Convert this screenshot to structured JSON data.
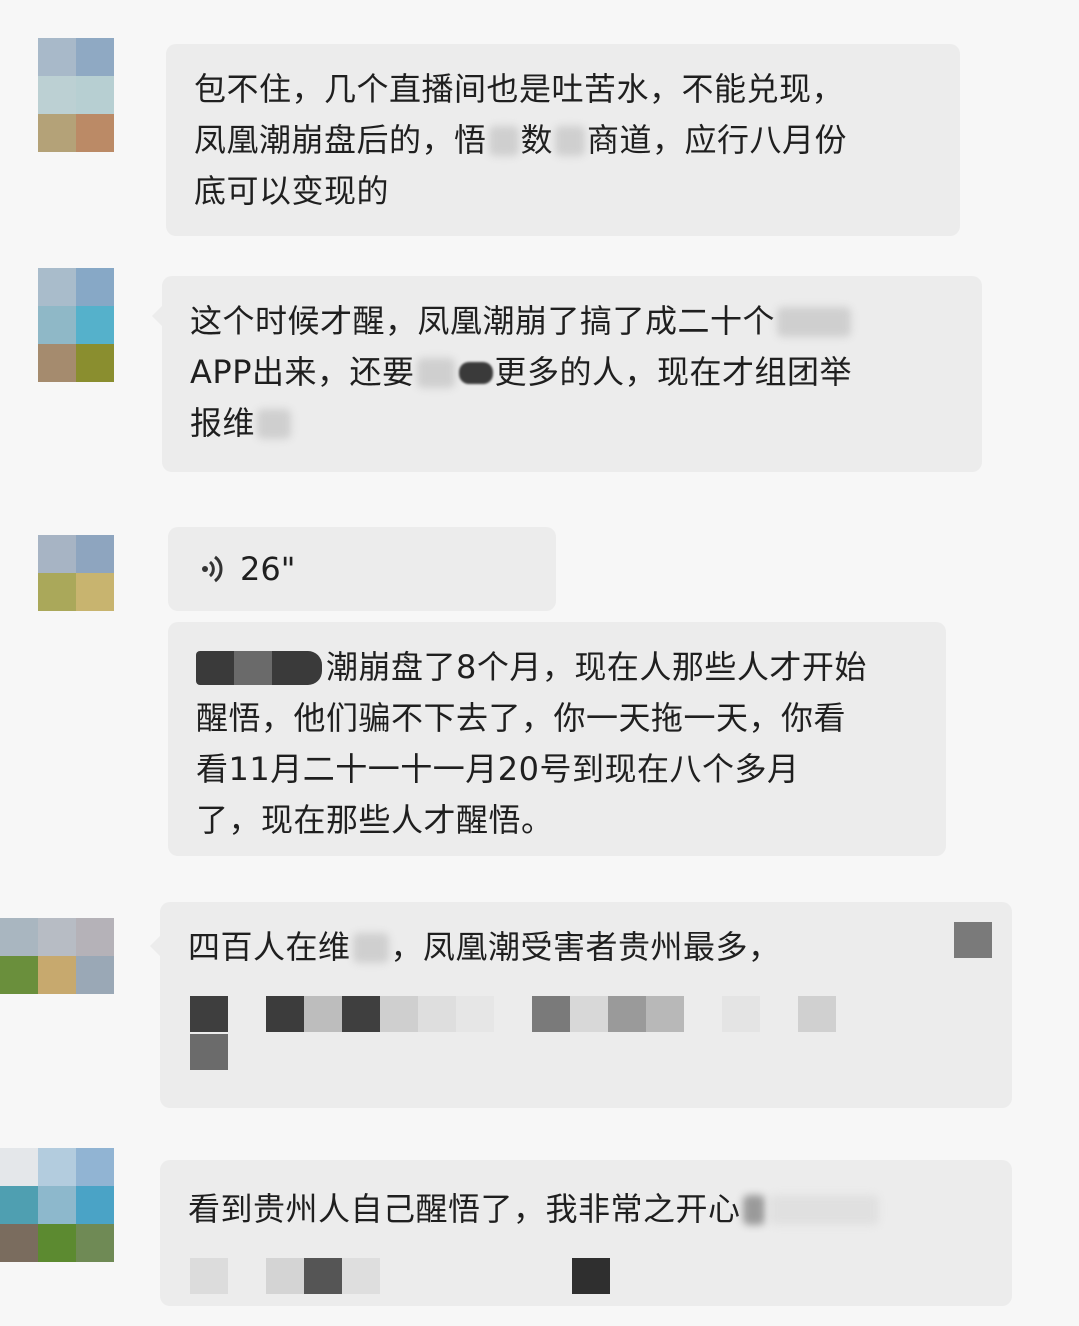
{
  "messages": [
    {
      "lines": [
        "包不住，几个直播间也是吐苦水，不能兑现，",
        "凤凰潮崩盘后的，悟",
        "数",
        "商道，应行八月份",
        "底可以变现的"
      ]
    },
    {
      "lines": [
        "这个时候才醒，凤凰潮崩了搞了成二十个",
        "APP出来，还要",
        "更多的人，现在才组团举",
        "报维"
      ]
    },
    {
      "voice": "26\"",
      "lines": [
        "潮崩盘了8个月，现在人那些人才开始",
        "醒悟，他们骗不下去了，你一天拖一天，你看",
        "看11月二十一十一月20号到现在八个多月",
        "了，现在那些人才醒悟。"
      ]
    },
    {
      "lines": [
        "四百人在维",
        "，凤凰潮受害者贵州最多，"
      ]
    },
    {
      "lines": [
        "看到贵州人自己醒悟了，我非常之开心"
      ]
    }
  ],
  "icons": {
    "voice": "voice-wave-icon"
  },
  "colors": {
    "bubble": "#ececec",
    "background": "#f7f7f7",
    "text": "#1f1f1f"
  }
}
